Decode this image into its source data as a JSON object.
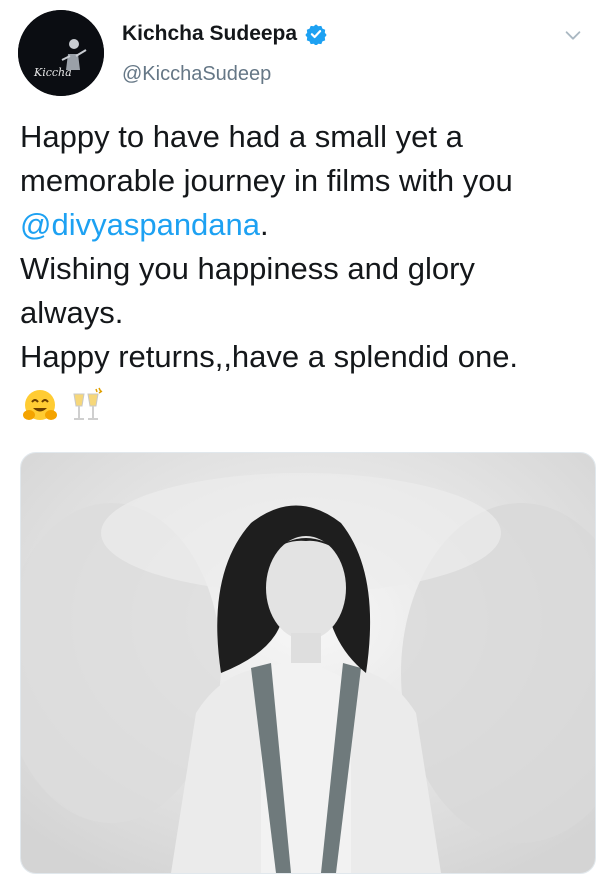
{
  "tweet": {
    "author": {
      "display_name": "Kichcha Sudeepa",
      "handle": "@KicchaSudeep",
      "verified": true,
      "avatar_signature": "Kiccha"
    },
    "text_before_mention": "Happy to have had a small yet a\nmemorable journey in films with you\n",
    "mention": "@divyaspandana",
    "text_after_mention": ".\nWishing you happiness and glory\nalways.\nHappy returns,,have a splendid one.",
    "emojis": [
      "hugging-face-emoji",
      "clinking-glasses-emoji"
    ],
    "media": {
      "type": "photo",
      "description_icon": "photo-icon"
    }
  },
  "colors": {
    "link": "#1da1f2",
    "verified_badge": "#1da1f2",
    "handle_gray": "#657786",
    "text": "#14171a"
  }
}
